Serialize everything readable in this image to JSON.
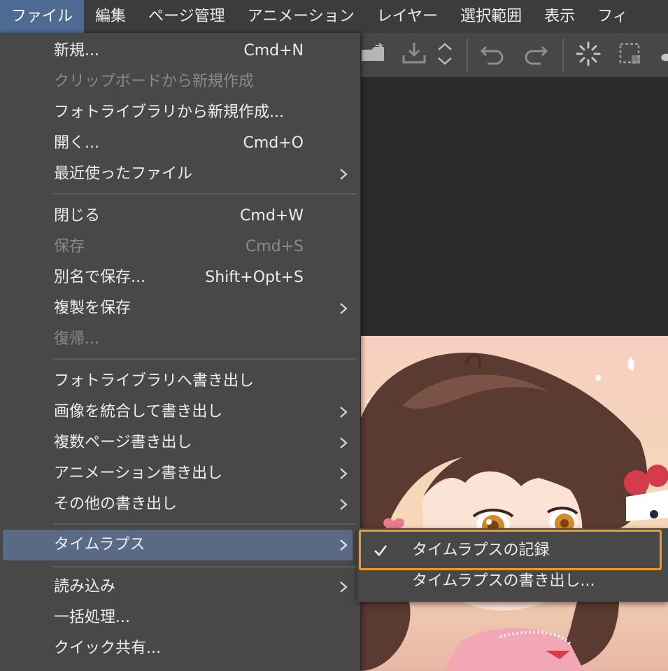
{
  "menubar": {
    "items": [
      "ファイル",
      "編集",
      "ページ管理",
      "アニメーション",
      "レイヤー",
      "選択範囲",
      "表示",
      "フィ"
    ]
  },
  "toolbar": {
    "icons": [
      "open-folder-icon",
      "export-icon",
      "up-down-icon",
      "undo-icon",
      "redo-icon",
      "loading-icon",
      "select-all-icon",
      "brush-icon"
    ]
  },
  "file_menu": {
    "items": [
      {
        "label": "新規...",
        "shortcut": "Cmd+N",
        "enabled": true,
        "submenu": false
      },
      {
        "label": "クリップボードから新規作成",
        "shortcut": "",
        "enabled": false,
        "submenu": false
      },
      {
        "label": "フォトライブラリから新規作成...",
        "shortcut": "",
        "enabled": true,
        "submenu": false
      },
      {
        "label": "開く...",
        "shortcut": "Cmd+O",
        "enabled": true,
        "submenu": false
      },
      {
        "label": "最近使ったファイル",
        "shortcut": "",
        "enabled": true,
        "submenu": true
      },
      {
        "label": "閉じる",
        "shortcut": "Cmd+W",
        "enabled": true,
        "submenu": false
      },
      {
        "label": "保存",
        "shortcut": "Cmd+S",
        "enabled": false,
        "submenu": false
      },
      {
        "label": "別名で保存...",
        "shortcut": "Shift+Opt+S",
        "enabled": true,
        "submenu": false
      },
      {
        "label": "複製を保存",
        "shortcut": "",
        "enabled": true,
        "submenu": true
      },
      {
        "label": "復帰...",
        "shortcut": "",
        "enabled": false,
        "submenu": false
      },
      {
        "label": "フォトライブラリへ書き出し",
        "shortcut": "",
        "enabled": true,
        "submenu": false
      },
      {
        "label": "画像を統合して書き出し",
        "shortcut": "",
        "enabled": true,
        "submenu": true
      },
      {
        "label": "複数ページ書き出し",
        "shortcut": "",
        "enabled": true,
        "submenu": true
      },
      {
        "label": "アニメーション書き出し",
        "shortcut": "",
        "enabled": true,
        "submenu": true
      },
      {
        "label": "その他の書き出し",
        "shortcut": "",
        "enabled": true,
        "submenu": true
      },
      {
        "label": "タイムラプス",
        "shortcut": "",
        "enabled": true,
        "submenu": true,
        "highlighted": true
      },
      {
        "label": "読み込み",
        "shortcut": "",
        "enabled": true,
        "submenu": true
      },
      {
        "label": "一括処理...",
        "shortcut": "",
        "enabled": true,
        "submenu": false
      },
      {
        "label": "クイック共有...",
        "shortcut": "",
        "enabled": true,
        "submenu": false
      }
    ]
  },
  "timelapse_submenu": {
    "items": [
      {
        "label": "タイムラプスの記録",
        "checked": true
      },
      {
        "label": "タイムラプスの書き出し...",
        "checked": false
      }
    ],
    "highlight_color": "#f29a1f"
  },
  "colors": {
    "menu_bg": "#484848",
    "menubar_active": "#4d6a93",
    "row_highlight": "#5b6a84"
  }
}
